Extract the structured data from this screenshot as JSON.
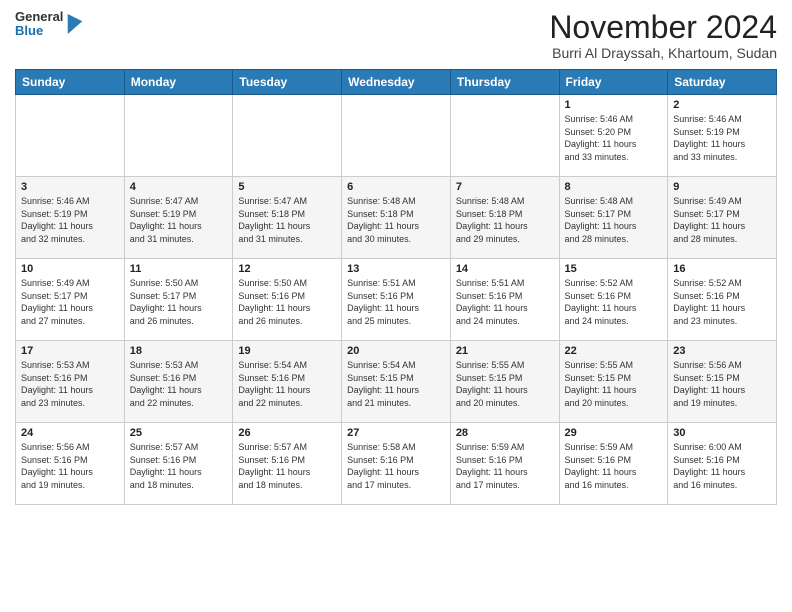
{
  "logo": {
    "line1": "General",
    "line2": "Blue"
  },
  "title": "November 2024",
  "subtitle": "Burri Al Drayssah, Khartoum, Sudan",
  "days_of_week": [
    "Sunday",
    "Monday",
    "Tuesday",
    "Wednesday",
    "Thursday",
    "Friday",
    "Saturday"
  ],
  "weeks": [
    [
      {
        "day": "",
        "info": ""
      },
      {
        "day": "",
        "info": ""
      },
      {
        "day": "",
        "info": ""
      },
      {
        "day": "",
        "info": ""
      },
      {
        "day": "",
        "info": ""
      },
      {
        "day": "1",
        "info": "Sunrise: 5:46 AM\nSunset: 5:20 PM\nDaylight: 11 hours\nand 33 minutes."
      },
      {
        "day": "2",
        "info": "Sunrise: 5:46 AM\nSunset: 5:19 PM\nDaylight: 11 hours\nand 33 minutes."
      }
    ],
    [
      {
        "day": "3",
        "info": "Sunrise: 5:46 AM\nSunset: 5:19 PM\nDaylight: 11 hours\nand 32 minutes."
      },
      {
        "day": "4",
        "info": "Sunrise: 5:47 AM\nSunset: 5:19 PM\nDaylight: 11 hours\nand 31 minutes."
      },
      {
        "day": "5",
        "info": "Sunrise: 5:47 AM\nSunset: 5:18 PM\nDaylight: 11 hours\nand 31 minutes."
      },
      {
        "day": "6",
        "info": "Sunrise: 5:48 AM\nSunset: 5:18 PM\nDaylight: 11 hours\nand 30 minutes."
      },
      {
        "day": "7",
        "info": "Sunrise: 5:48 AM\nSunset: 5:18 PM\nDaylight: 11 hours\nand 29 minutes."
      },
      {
        "day": "8",
        "info": "Sunrise: 5:48 AM\nSunset: 5:17 PM\nDaylight: 11 hours\nand 28 minutes."
      },
      {
        "day": "9",
        "info": "Sunrise: 5:49 AM\nSunset: 5:17 PM\nDaylight: 11 hours\nand 28 minutes."
      }
    ],
    [
      {
        "day": "10",
        "info": "Sunrise: 5:49 AM\nSunset: 5:17 PM\nDaylight: 11 hours\nand 27 minutes."
      },
      {
        "day": "11",
        "info": "Sunrise: 5:50 AM\nSunset: 5:17 PM\nDaylight: 11 hours\nand 26 minutes."
      },
      {
        "day": "12",
        "info": "Sunrise: 5:50 AM\nSunset: 5:16 PM\nDaylight: 11 hours\nand 26 minutes."
      },
      {
        "day": "13",
        "info": "Sunrise: 5:51 AM\nSunset: 5:16 PM\nDaylight: 11 hours\nand 25 minutes."
      },
      {
        "day": "14",
        "info": "Sunrise: 5:51 AM\nSunset: 5:16 PM\nDaylight: 11 hours\nand 24 minutes."
      },
      {
        "day": "15",
        "info": "Sunrise: 5:52 AM\nSunset: 5:16 PM\nDaylight: 11 hours\nand 24 minutes."
      },
      {
        "day": "16",
        "info": "Sunrise: 5:52 AM\nSunset: 5:16 PM\nDaylight: 11 hours\nand 23 minutes."
      }
    ],
    [
      {
        "day": "17",
        "info": "Sunrise: 5:53 AM\nSunset: 5:16 PM\nDaylight: 11 hours\nand 23 minutes."
      },
      {
        "day": "18",
        "info": "Sunrise: 5:53 AM\nSunset: 5:16 PM\nDaylight: 11 hours\nand 22 minutes."
      },
      {
        "day": "19",
        "info": "Sunrise: 5:54 AM\nSunset: 5:16 PM\nDaylight: 11 hours\nand 22 minutes."
      },
      {
        "day": "20",
        "info": "Sunrise: 5:54 AM\nSunset: 5:15 PM\nDaylight: 11 hours\nand 21 minutes."
      },
      {
        "day": "21",
        "info": "Sunrise: 5:55 AM\nSunset: 5:15 PM\nDaylight: 11 hours\nand 20 minutes."
      },
      {
        "day": "22",
        "info": "Sunrise: 5:55 AM\nSunset: 5:15 PM\nDaylight: 11 hours\nand 20 minutes."
      },
      {
        "day": "23",
        "info": "Sunrise: 5:56 AM\nSunset: 5:15 PM\nDaylight: 11 hours\nand 19 minutes."
      }
    ],
    [
      {
        "day": "24",
        "info": "Sunrise: 5:56 AM\nSunset: 5:16 PM\nDaylight: 11 hours\nand 19 minutes."
      },
      {
        "day": "25",
        "info": "Sunrise: 5:57 AM\nSunset: 5:16 PM\nDaylight: 11 hours\nand 18 minutes."
      },
      {
        "day": "26",
        "info": "Sunrise: 5:57 AM\nSunset: 5:16 PM\nDaylight: 11 hours\nand 18 minutes."
      },
      {
        "day": "27",
        "info": "Sunrise: 5:58 AM\nSunset: 5:16 PM\nDaylight: 11 hours\nand 17 minutes."
      },
      {
        "day": "28",
        "info": "Sunrise: 5:59 AM\nSunset: 5:16 PM\nDaylight: 11 hours\nand 17 minutes."
      },
      {
        "day": "29",
        "info": "Sunrise: 5:59 AM\nSunset: 5:16 PM\nDaylight: 11 hours\nand 16 minutes."
      },
      {
        "day": "30",
        "info": "Sunrise: 6:00 AM\nSunset: 5:16 PM\nDaylight: 11 hours\nand 16 minutes."
      }
    ]
  ]
}
